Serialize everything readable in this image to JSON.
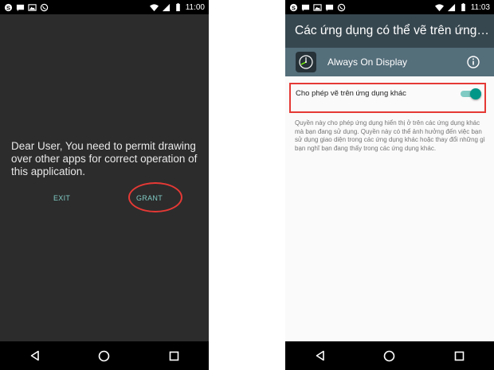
{
  "left": {
    "status_time": "11:00",
    "message": "Dear User, You need to permit drawing over other apps for correct operation of this application.",
    "exit_label": "EXIT",
    "grant_label": "GRANT"
  },
  "right": {
    "status_time": "11:03",
    "header_title": "Các ứng dụng có thể vẽ trên ứng d...",
    "app_name": "Always On Display",
    "permission_label": "Cho phép vẽ trên ứng dụng khác",
    "permission_enabled": true,
    "permission_description": "Quyền này cho phép ứng dụng hiển thị ở trên các ứng dụng khác mà bạn đang sử dụng. Quyền này có thể ảnh hưởng đến việc bạn sử dụng giao diện trong các ứng dụng khác hoặc thay đổi những gì bạn nghĩ bạn đang thấy trong các ứng dụng khác."
  },
  "colors": {
    "dialog_background": "#2c2c2c",
    "button_text": "#80cbc4",
    "highlight": "#e53935",
    "toolbar": "#37474f",
    "app_row": "#546e7a",
    "toggle_on": "#009688"
  },
  "icons": [
    "skype-icon",
    "message-icon",
    "image-icon",
    "viber-icon",
    "wifi-icon",
    "signal-icon",
    "battery-icon",
    "back-icon",
    "home-icon",
    "recents-icon",
    "clock-icon",
    "info-icon"
  ]
}
